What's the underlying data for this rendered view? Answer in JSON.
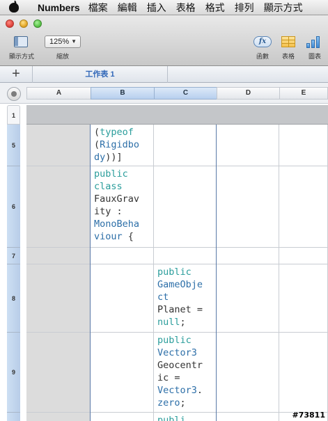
{
  "menubar": {
    "app_name": "Numbers",
    "items": [
      "檔案",
      "編輯",
      "插入",
      "表格",
      "格式",
      "排列",
      "顯示方式"
    ]
  },
  "toolbar": {
    "view_label": "顯示方式",
    "zoom_value": "125%",
    "zoom_label": "縮放",
    "function_label": "函數",
    "function_icon_text": "fx",
    "table_label": "表格",
    "chart_label": "圖表"
  },
  "sheets": {
    "add_label": "+",
    "active_tab": "工作表 1"
  },
  "columns": [
    "A",
    "B",
    "C",
    "D",
    "E"
  ],
  "header_row_label": "1",
  "rows": [
    {
      "num": "5",
      "b": [
        [
          "(",
          ""
        ],
        [
          "typeof",
          "kw"
        ],
        [
          "\n(",
          ""
        ],
        [
          "Rigidbo",
          "ty"
        ],
        [
          "\n",
          ""
        ],
        [
          "dy",
          "ty"
        ],
        [
          "))]",
          ""
        ]
      ],
      "c": []
    },
    {
      "num": "6",
      "b": [
        [
          "public",
          "kw"
        ],
        [
          "\n",
          ""
        ],
        [
          "class",
          "kw"
        ],
        [
          "\nFauxGrav\nity :\n",
          ""
        ],
        [
          "MonoBeha",
          "ty"
        ],
        [
          "\n",
          ""
        ],
        [
          "viour",
          "ty"
        ],
        [
          " {",
          ""
        ]
      ],
      "c": []
    },
    {
      "num": "7",
      "b": [],
      "c": []
    },
    {
      "num": "8",
      "b": [],
      "c": [
        [
          "public",
          "kw"
        ],
        [
          "\n",
          ""
        ],
        [
          "GameObje",
          "ty"
        ],
        [
          "\n",
          ""
        ],
        [
          "ct",
          "ty"
        ],
        [
          "\nPlanet =\n",
          ""
        ],
        [
          "null",
          "kw"
        ],
        [
          ";",
          ""
        ]
      ]
    },
    {
      "num": "9",
      "b": [],
      "c": [
        [
          "public",
          "kw"
        ],
        [
          "\n",
          ""
        ],
        [
          "Vector3",
          "ty"
        ],
        [
          "\nGeocentr\nic =\n",
          ""
        ],
        [
          "Vector3",
          "ty"
        ],
        [
          ".\n",
          ""
        ],
        [
          "zero",
          "ty"
        ],
        [
          ";",
          ""
        ]
      ]
    },
    {
      "num": "",
      "b": [],
      "c": [
        [
          "publi",
          "kw"
        ]
      ]
    }
  ],
  "watermark": "#73811",
  "colors": {
    "keyword": "#2a9d9b",
    "type": "#2d6fa8",
    "selection": "#b7cfee",
    "frozen_header": "#c4c6c9"
  }
}
